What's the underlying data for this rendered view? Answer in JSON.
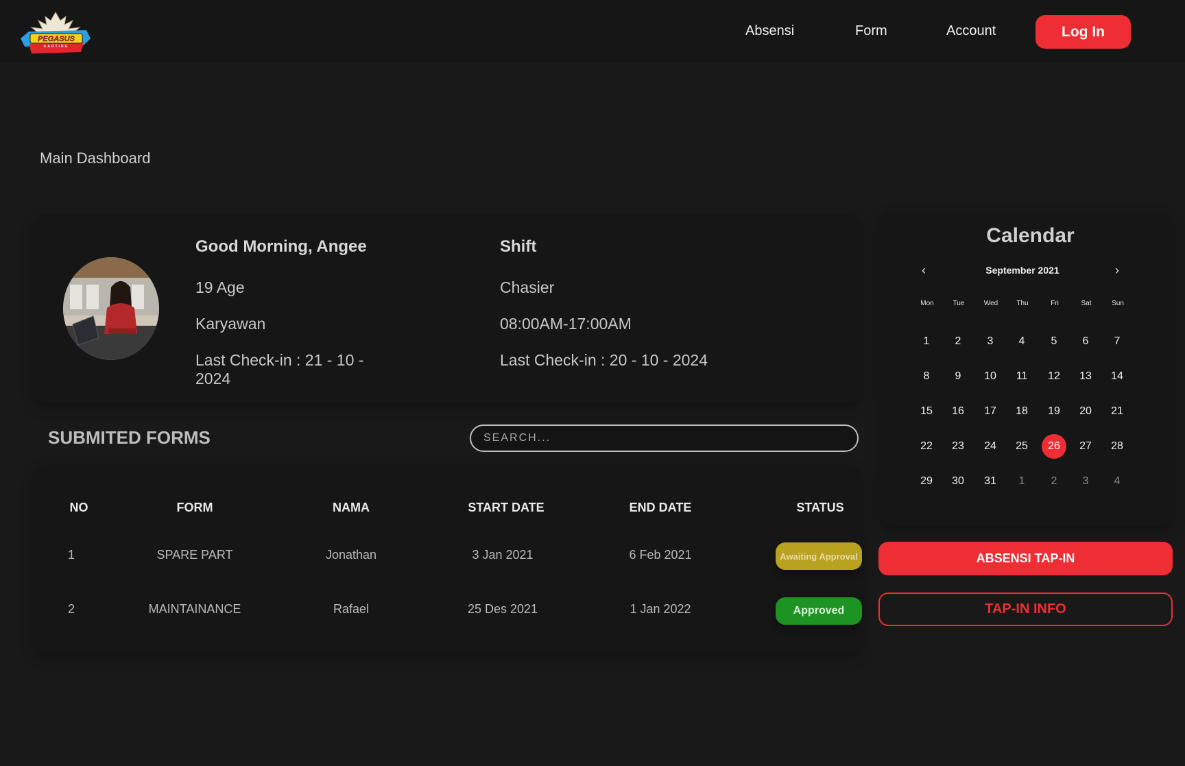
{
  "logo": {
    "text": "PEGASUS",
    "subtext": "KARTING",
    "colors": {
      "blue": "#2b9fe0",
      "red": "#e3262d",
      "yellow": "#f4d21c"
    }
  },
  "nav": {
    "items": [
      "Absensi",
      "Form",
      "Account"
    ],
    "login_label": "Log In"
  },
  "page_title": "Main Dashboard",
  "profile": {
    "greeting": "Good Morning, Angee",
    "age": "19 Age",
    "role": "Karyawan",
    "last_checkin_1": "Last Check-in : 21 - 10 - 2024",
    "shift_title": "Shift",
    "position": "Chasier",
    "hours": "08:00AM-17:00AM",
    "last_checkin_2": "Last Check-in : 20 - 10 - 2024"
  },
  "forms": {
    "title": "SUBMITED FORMS",
    "search_placeholder": "SEARCH...",
    "headers": [
      "NO",
      "FORM",
      "NAMA",
      "START DATE",
      "END DATE",
      "STATUS"
    ],
    "rows": [
      {
        "no": "1",
        "form": "SPARE PART",
        "nama": "Jonathan",
        "start": "3 Jan 2021",
        "end": "6 Feb 2021",
        "status": "Awaiting Approval"
      },
      {
        "no": "2",
        "form": "MAINTAINANCE",
        "nama": "Rafael",
        "start": "25 Des 2021",
        "end": "1 Jan 2022",
        "status": "Approved"
      }
    ]
  },
  "calendar": {
    "title": "Calendar",
    "month": "September 2021",
    "prev": "‹",
    "next": "›",
    "weekdays": [
      "Mon",
      "Tue",
      "Wed",
      "Thu",
      "Fri",
      "Sat",
      "Sun"
    ],
    "weeks": [
      [
        "1",
        "2",
        "3",
        "4",
        "5",
        "6",
        "7"
      ],
      [
        "8",
        "9",
        "10",
        "11",
        "12",
        "13",
        "14"
      ],
      [
        "15",
        "16",
        "17",
        "18",
        "19",
        "20",
        "21"
      ],
      [
        "22",
        "23",
        "24",
        "25",
        "26",
        "27",
        "28"
      ],
      [
        "29",
        "30",
        "31",
        "1",
        "2",
        "3",
        "4"
      ]
    ],
    "selected": "26"
  },
  "actions": {
    "tap_in": "ABSENSI TAP-IN",
    "tap_in_info": "TAP-IN INFO"
  },
  "colors": {
    "accent": "#ee2e34",
    "awaiting": "#b8a21f",
    "approved": "#1d9324"
  }
}
